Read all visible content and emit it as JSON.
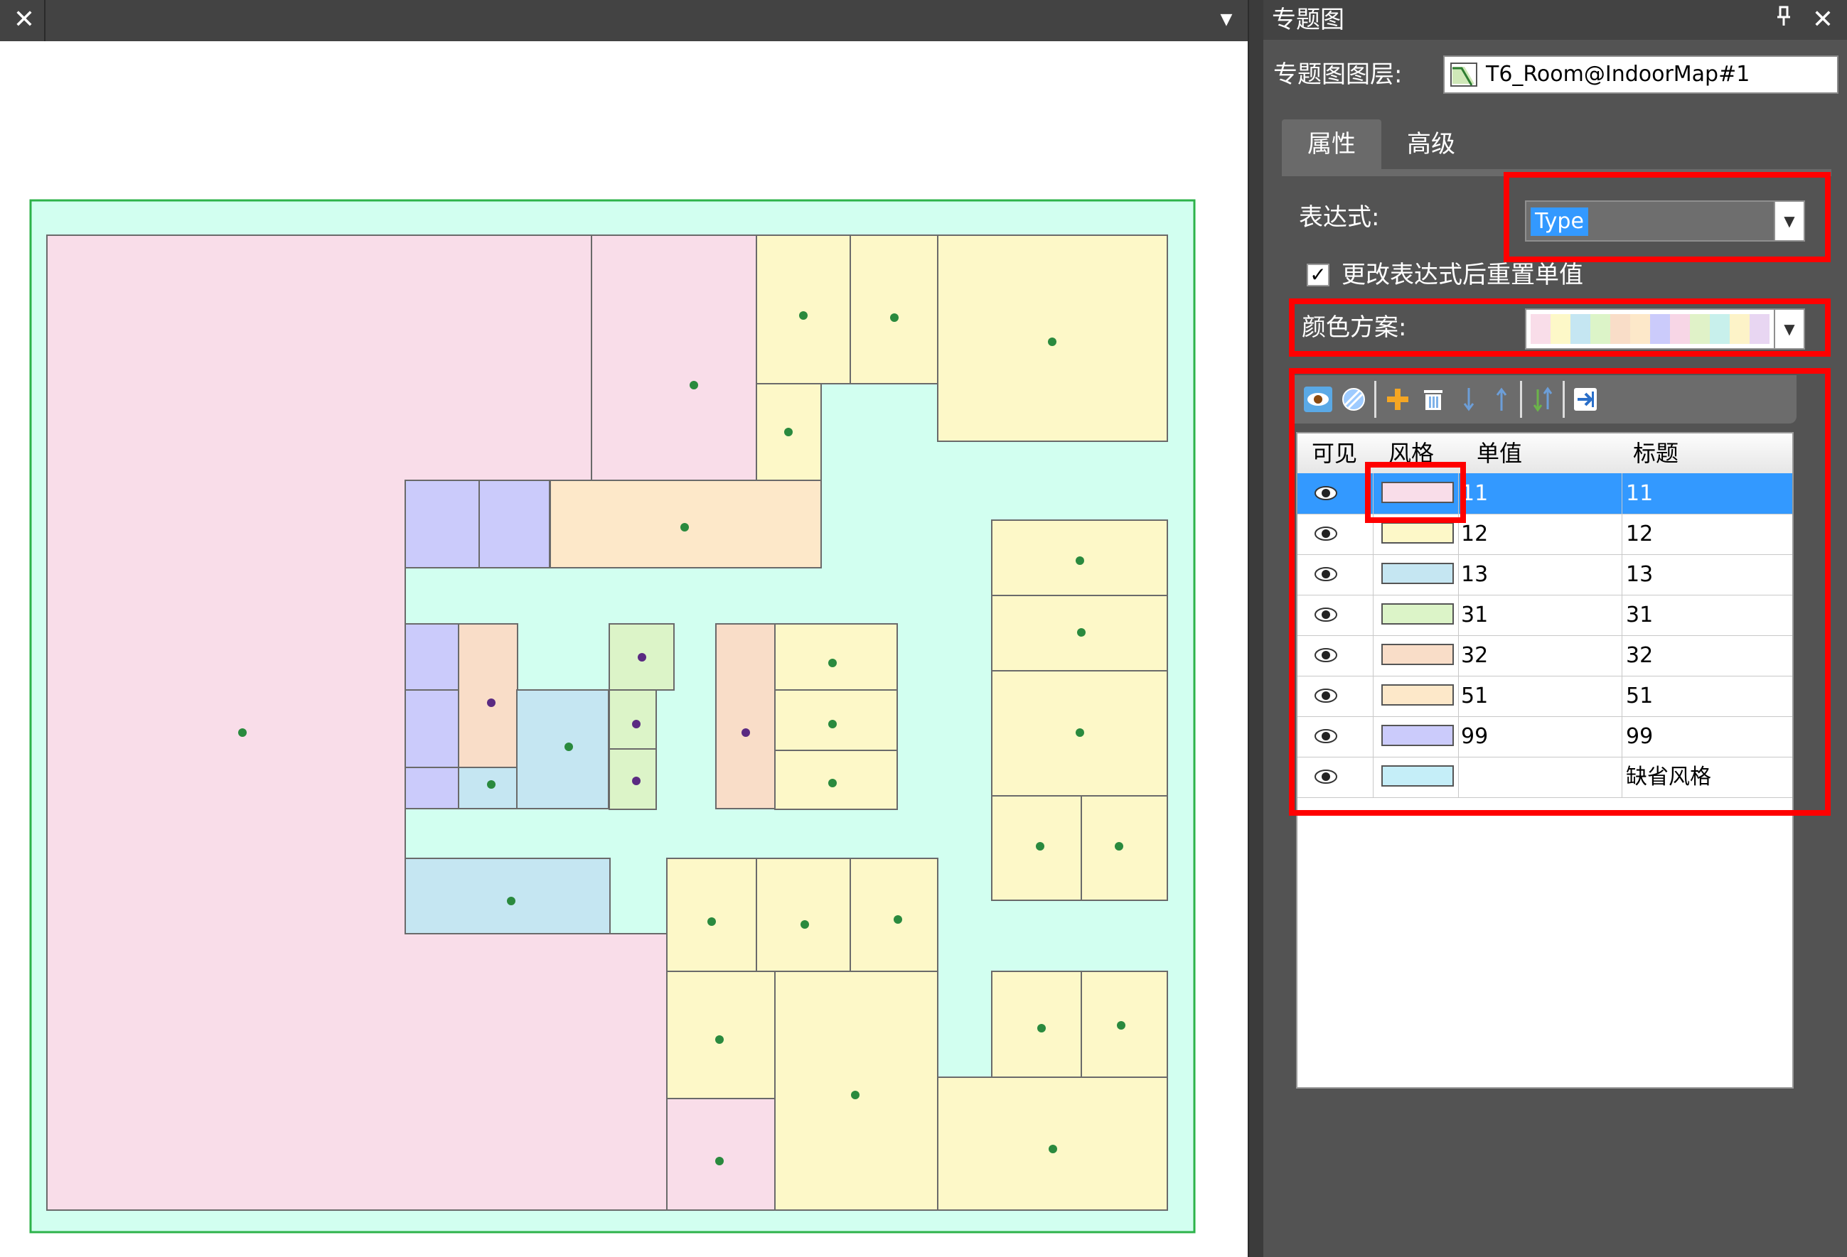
{
  "map_window": {
    "close_glyph": "✕",
    "dropdown_glyph": "▼",
    "colors": {
      "background": "#d2fff0",
      "border": "#2db34a",
      "pink": "#f9dde9",
      "yellow": "#fdf8c8",
      "orange": "#fde8c9",
      "lavender": "#cbcbfb",
      "blue": "#c5e6f2",
      "green": "#dcf4c8",
      "peach": "#f9ddc8",
      "point_green": "#2a8a3e",
      "point_purple": "#5a2a82"
    }
  },
  "panel": {
    "title": "专题图",
    "pin_glyph": "ꟷ",
    "close_glyph": "✕",
    "layer_label": "专题图图层:",
    "layer_value": "T6_Room@IndoorMap#1",
    "tabs": [
      {
        "label": "属性",
        "active": true
      },
      {
        "label": "高级",
        "active": false
      }
    ],
    "expression_label": "表达式:",
    "expression_value": "Type",
    "reset_checked": true,
    "reset_label": "更改表达式后重置单值",
    "scheme_label": "颜色方案:",
    "scheme_colors": [
      "#f9dde9",
      "#fdf8c8",
      "#c5e6f2",
      "#dcf4c8",
      "#f9ddc8",
      "#fde8c9",
      "#cbcbfb",
      "#f7d6e6",
      "#e0f2c8",
      "#c8f0ec",
      "#fdf3c8",
      "#e8d6f2"
    ],
    "toolbar": [
      "visible-icon",
      "style-icon",
      "add-icon",
      "delete-icon",
      "move-down-icon",
      "move-up-icon",
      "sort-icon",
      "export-icon"
    ],
    "grid": {
      "headers": {
        "visible": "可见",
        "style": "风格",
        "value": "单值",
        "title": "标题"
      },
      "rows": [
        {
          "value": "11",
          "title": "11",
          "color": "#f9dde9",
          "selected": true
        },
        {
          "value": "12",
          "title": "12",
          "color": "#fdf8c8",
          "selected": false
        },
        {
          "value": "13",
          "title": "13",
          "color": "#c5e6f2",
          "selected": false
        },
        {
          "value": "31",
          "title": "31",
          "color": "#dcf4c8",
          "selected": false
        },
        {
          "value": "32",
          "title": "32",
          "color": "#f9ddc8",
          "selected": false
        },
        {
          "value": "51",
          "title": "51",
          "color": "#fde8c9",
          "selected": false
        },
        {
          "value": "99",
          "title": "99",
          "color": "#cbcbfb",
          "selected": false
        },
        {
          "value": "",
          "title": "缺省风格",
          "color": "#c5eef8",
          "selected": false
        }
      ]
    }
  }
}
